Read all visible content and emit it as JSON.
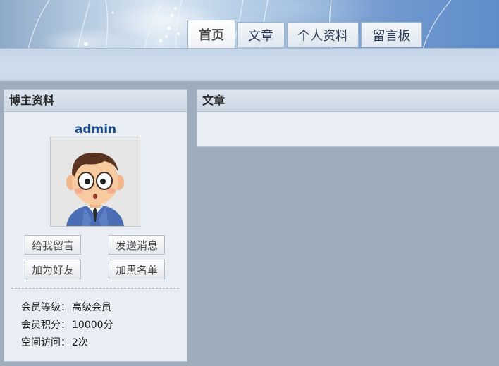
{
  "nav": {
    "tabs": [
      {
        "label": "首页",
        "active": true
      },
      {
        "label": "文章",
        "active": false
      },
      {
        "label": "个人资料",
        "active": false
      },
      {
        "label": "留言板",
        "active": false
      }
    ]
  },
  "profile_panel": {
    "title": "博主资料",
    "username": "admin",
    "buttons": {
      "leave_message": "给我留言",
      "send_message": "发送消息",
      "add_friend": "加为好友",
      "blacklist": "加黑名单"
    },
    "stats": [
      {
        "label": "会员等级：",
        "value": "高级会员"
      },
      {
        "label": "会员积分：",
        "value": "10000分"
      },
      {
        "label": "空间访问：",
        "value": "2次"
      }
    ]
  },
  "articles_panel": {
    "title": "文章"
  },
  "colors": {
    "background": "#9dadbe",
    "panel_bg": "#e9eef4",
    "username": "#1b4a86"
  }
}
